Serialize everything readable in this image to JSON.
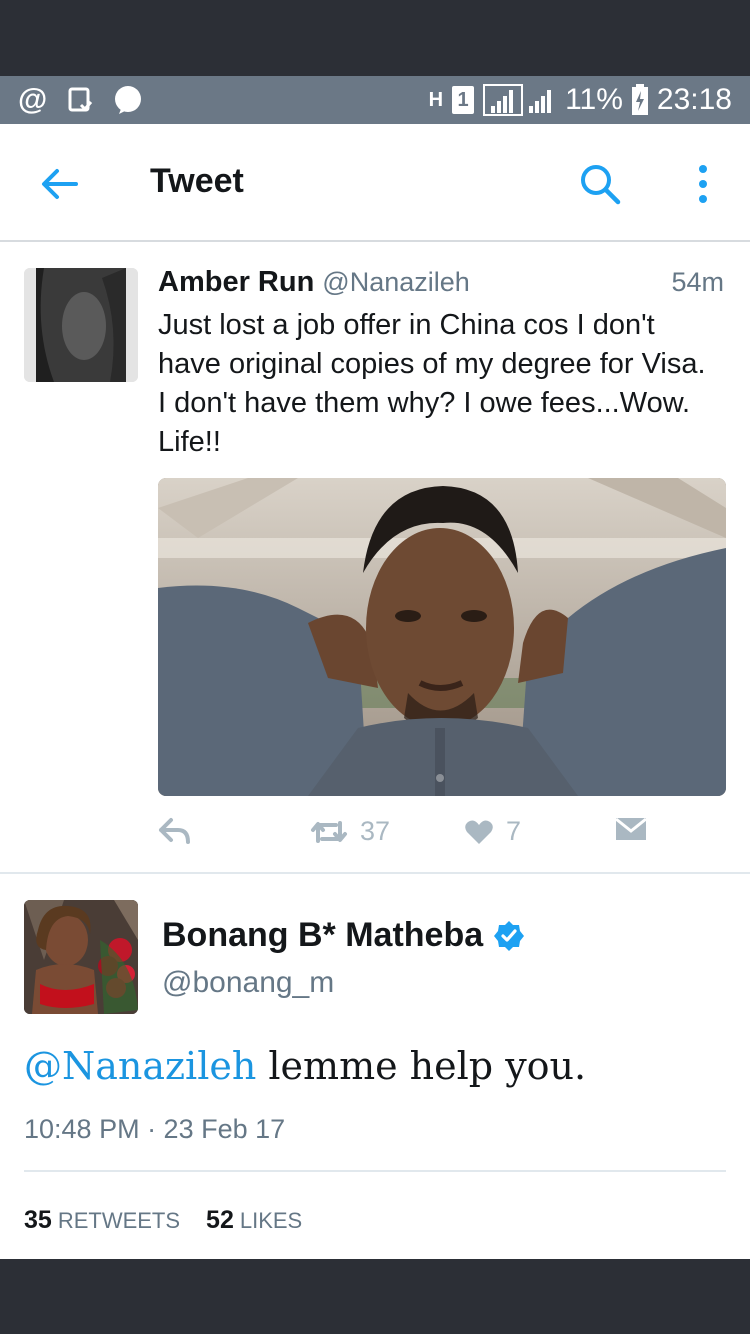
{
  "status_bar": {
    "network_label": "H",
    "sim_label": "1",
    "battery_percent": "11%",
    "time": "23:18",
    "icons": [
      "at-sign-icon",
      "clipboard-icon",
      "messenger-icon",
      "signal-icon",
      "battery-icon"
    ]
  },
  "app_bar": {
    "title": "Tweet",
    "back_icon": "arrow-left-icon",
    "search_icon": "search-icon",
    "more_icon": "more-vertical-icon"
  },
  "tweet1": {
    "display_name": "Amber Run",
    "handle": "@Nanazileh",
    "time_ago": "54m",
    "text": "Just lost a job offer in China cos I don't have original copies of my degree for Visa. I don't have them why? I owe fees...Wow. Life!!",
    "retweet_count": "37",
    "like_count": "7",
    "colors": {
      "action_gray": "#aab8c2"
    }
  },
  "tweet2": {
    "display_name": "Bonang B* Matheba",
    "handle": "@bonang_m",
    "verified": true,
    "mention": "@Nanazileh",
    "text": " lemme help you.",
    "date": "10:48 PM · 23 Feb 17",
    "retweets_count": "35",
    "retweets_label": "RETWEETS",
    "likes_count": "52",
    "likes_label": "LIKES",
    "colors": {
      "mention_blue": "#1b95e0",
      "verified_blue": "#1da1f2"
    }
  }
}
